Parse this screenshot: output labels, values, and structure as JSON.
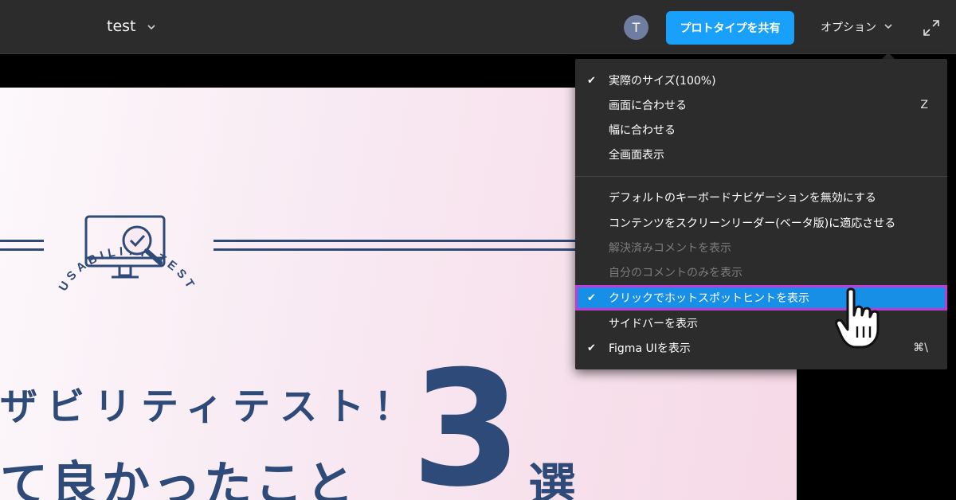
{
  "topbar": {
    "file_title": "test",
    "avatar_initial": "T",
    "share_button": "プロトタイプを共有",
    "options_label": "オプション"
  },
  "canvas": {
    "badge_arc_text": "USABILITY TEST",
    "headline_line1": "ザビリティテスト！",
    "headline_line2": "て良かったこと",
    "big_number": "3",
    "headline_suffix": "選",
    "colors": {
      "navy": "#2e4a79",
      "bg_light": "#fcf8fb",
      "bg_pink": "#f6d9e6"
    }
  },
  "menu": {
    "items": [
      {
        "label": "実際のサイズ(100%)",
        "checked": true,
        "shortcut": "",
        "disabled": false
      },
      {
        "label": "画面に合わせる",
        "checked": false,
        "shortcut": "Z",
        "disabled": false
      },
      {
        "label": "幅に合わせる",
        "checked": false,
        "shortcut": "",
        "disabled": false
      },
      {
        "label": "全画面表示",
        "checked": false,
        "shortcut": "",
        "disabled": false
      },
      {
        "label": "デフォルトのキーボードナビゲーションを無効にする",
        "checked": false,
        "shortcut": "",
        "disabled": false
      },
      {
        "label": "コンテンツをスクリーンリーダー(ベータ版)に適応させる",
        "checked": false,
        "shortcut": "",
        "disabled": false
      },
      {
        "label": "解決済みコメントを表示",
        "checked": false,
        "shortcut": "",
        "disabled": true
      },
      {
        "label": "自分のコメントのみを表示",
        "checked": false,
        "shortcut": "",
        "disabled": true
      },
      {
        "label": "クリックでホットスポットヒントを表示",
        "checked": true,
        "shortcut": "",
        "disabled": false,
        "highlighted": true
      },
      {
        "label": "サイドバーを表示",
        "checked": false,
        "shortcut": "",
        "disabled": false
      },
      {
        "label": "Figma UIを表示",
        "checked": true,
        "shortcut": "⌘\\",
        "disabled": false
      }
    ],
    "check_glyph": "✔",
    "colors": {
      "menu_bg": "#2c2c2c",
      "highlight": "#188fe6",
      "highlight_border": "#c23ad4",
      "disabled_text": "#7d7d7d"
    }
  },
  "icons": {
    "file_chevron": "chevron-down-icon",
    "options_chevron": "chevron-down-icon",
    "expand": "expand-icon",
    "monitor": "monitor-magnifier-icon",
    "cursor": "hand-pointer-icon"
  },
  "chevron_glyph": "⌄"
}
